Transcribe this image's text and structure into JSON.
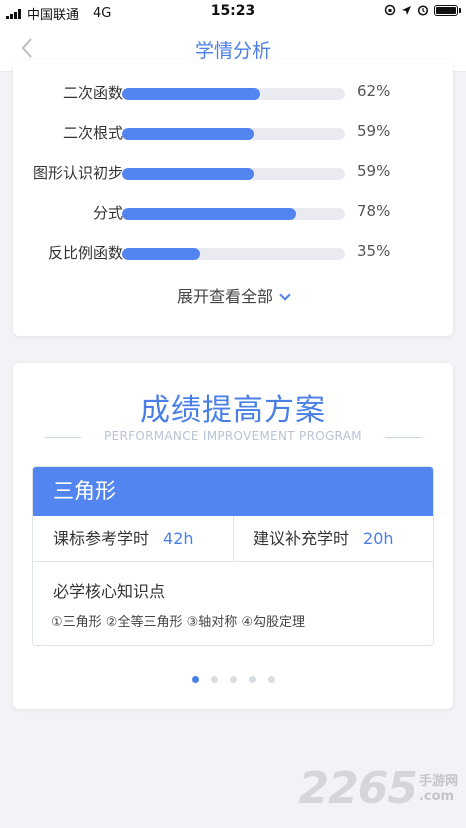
{
  "status_bar": {
    "carrier": "中国联通",
    "network": "4G",
    "time": "15:23"
  },
  "nav": {
    "title": "学情分析",
    "back_icon": "chevron-left-icon"
  },
  "progress": {
    "items": [
      {
        "label": "二次函数",
        "percent_text": "62%",
        "value": 62
      },
      {
        "label": "二次根式",
        "percent_text": "59%",
        "value": 59
      },
      {
        "label": "图形认识初步",
        "percent_text": "59%",
        "value": 59
      },
      {
        "label": "分式",
        "percent_text": "78%",
        "value": 78
      },
      {
        "label": "反比例函数",
        "percent_text": "35%",
        "value": 35
      }
    ],
    "expand_label": "展开查看全部"
  },
  "plan": {
    "title": "成绩提高方案",
    "subtitle": "PERFORMANCE IMPROVEMENT PROGRAM",
    "topic": "三角形",
    "standard_hours_label": "课标参考学时",
    "standard_hours_value": "42h",
    "suggested_hours_label": "建议补充学时",
    "suggested_hours_value": "20h",
    "knowledge_title": "必学核心知识点",
    "knowledge_points": "①三角形 ②全等三角形 ③轴对称 ④勾股定理",
    "pager": {
      "count": 5,
      "active": 0
    }
  },
  "watermark": {
    "number": "2265",
    "suffix": ".com",
    "text": "手游网"
  },
  "colors": {
    "accent": "#4a7fe6",
    "bar_fill": "#5285f0",
    "bar_track": "#e9ebf0"
  }
}
